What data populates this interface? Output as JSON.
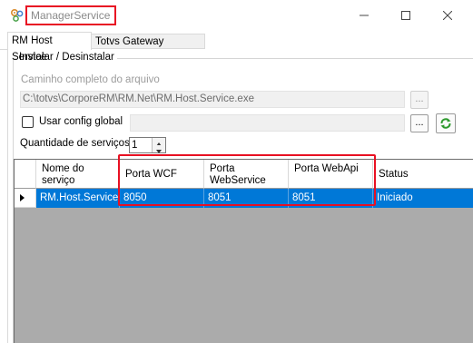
{
  "window": {
    "title": "ManagerService",
    "app_icon": "gears-icon",
    "controls": [
      "minimize-icon",
      "maximize-icon",
      "close-icon"
    ],
    "highlight_color": "#e81123"
  },
  "tabs": [
    {
      "label": "RM Host Service",
      "selected": true
    },
    {
      "label": "Totvs Gateway Manager",
      "selected": false
    }
  ],
  "install_group": {
    "label": "Instalar / Desinstalar",
    "path_label": "Caminho completo do arquivo",
    "path_value": "C:\\totvs\\CorporeRM\\RM.Net\\RM.Host.Service.exe",
    "browse_label": "...",
    "config_label": "Usar config global",
    "config_checked": false,
    "config_browse_label": "...",
    "refresh_icon": "refresh-icon",
    "quantity_label": "Quantidade de serviços",
    "quantity_value": "1"
  },
  "grid": {
    "columns": [
      "Nome do serviço",
      "Porta WCF",
      "Porta WebService",
      "Porta WebApi",
      "Status"
    ],
    "rows": [
      {
        "nome": "RM.Host.Service",
        "wcf": "8050",
        "webservice": "8051",
        "webapi": "8051",
        "status": "Iniciado",
        "selected": true
      }
    ],
    "selection_color": "#0078d7"
  }
}
